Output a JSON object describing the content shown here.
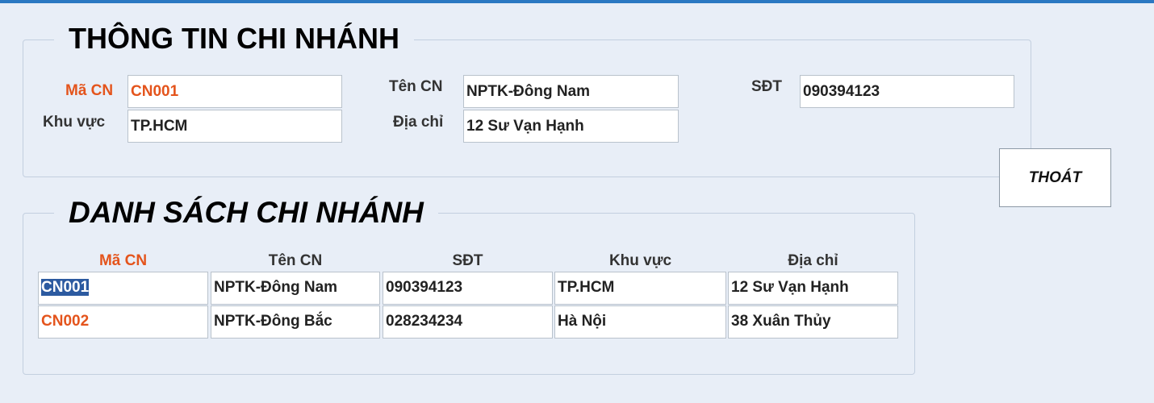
{
  "info": {
    "title": "THÔNG TIN CHI NHÁNH",
    "labels": {
      "ma_cn": "Mã CN",
      "ten_cn": "Tên CN",
      "sdt": "SĐT",
      "khu_vuc": "Khu vực",
      "dia_chi": "Địa chỉ"
    },
    "values": {
      "ma_cn": "CN001",
      "ten_cn": "NPTK-Đông Nam",
      "sdt": "090394123",
      "khu_vuc": "TP.HCM",
      "dia_chi": "12 Sư Vạn Hạnh"
    }
  },
  "exit_button": {
    "label": "THOÁT"
  },
  "list": {
    "title": "DANH SÁCH CHI NHÁNH",
    "columns": [
      "Mã CN",
      "Tên CN",
      "SĐT",
      "Khu vực",
      "Địa chỉ"
    ],
    "rows": [
      [
        "CN001",
        "NPTK-Đông Nam",
        "090394123",
        "TP.HCM",
        "12 Sư Vạn Hạnh"
      ],
      [
        "CN002",
        "NPTK-Đông Bắc",
        "028234234",
        "Hà Nội",
        "38 Xuân Thủy"
      ]
    ],
    "selected_row": 0
  },
  "colors": {
    "key_text": "#e4541c",
    "background": "#e8eef7",
    "selection": "#2c5aa0"
  }
}
